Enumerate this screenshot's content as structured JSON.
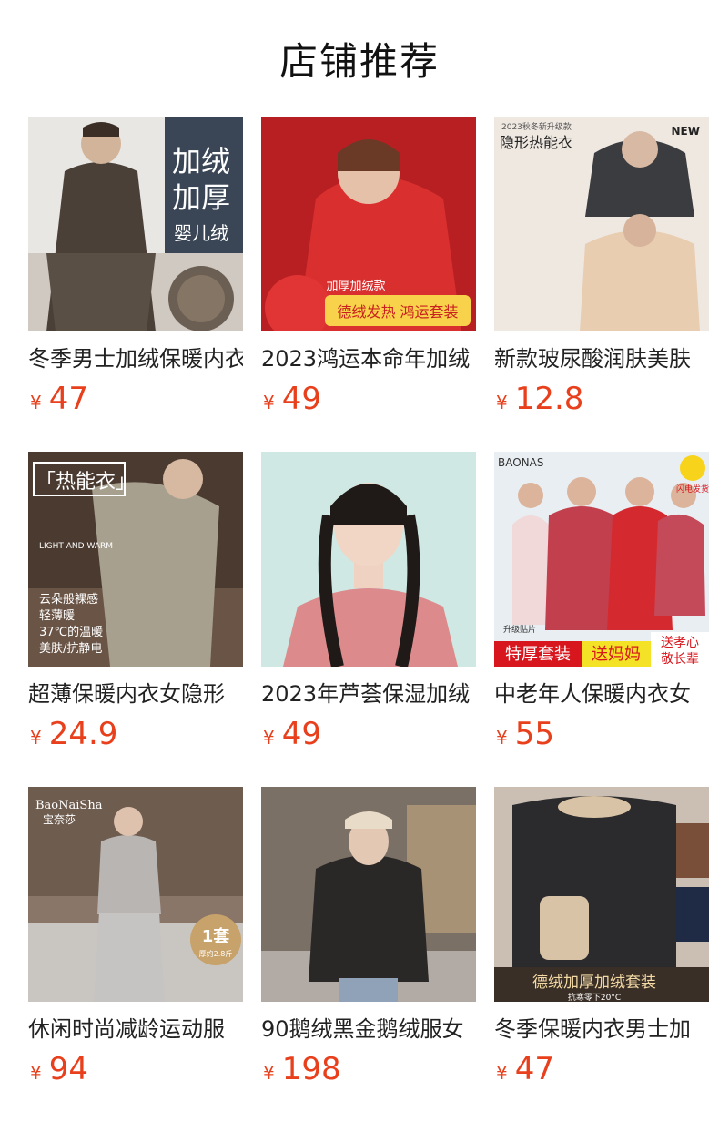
{
  "page": {
    "title": "店铺推荐"
  },
  "products": [
    {
      "title": "冬季男士加绒保暖内衣",
      "currency": "¥",
      "price": "47",
      "thumb_text": [
        "加绒",
        "加厚",
        "婴儿绒"
      ]
    },
    {
      "title": "2023鸿运本命年加绒",
      "currency": "¥",
      "price": "49",
      "thumb_text": [
        "加厚加绒款",
        "德绒发热 鸿运套装"
      ]
    },
    {
      "title": "新款玻尿酸润肤美肤",
      "currency": "¥",
      "price": "12.8",
      "thumb_text": [
        "2023秋冬新升级款",
        "隐形热能衣",
        "NEW"
      ]
    },
    {
      "title": "超薄保暖内衣女隐形",
      "currency": "¥",
      "price": "24.9",
      "thumb_text": [
        "「热能衣」",
        "LIGHT AND WARM",
        "云朵般裸感",
        "轻薄暖",
        "37℃的温暖",
        "美肤/抗静电"
      ]
    },
    {
      "title": "2023年芦荟保湿加绒",
      "currency": "¥",
      "price": "49",
      "thumb_text": []
    },
    {
      "title": "中老年人保暖内衣女",
      "currency": "¥",
      "price": "55",
      "thumb_text": [
        "BAONAS",
        "闪电发货",
        "特厚套装",
        "送妈妈",
        "送孝心",
        "敬长辈",
        "升级贴片"
      ]
    },
    {
      "title": "休闲时尚减龄运动服",
      "currency": "¥",
      "price": "94",
      "thumb_text": [
        "BaoNaiSha",
        "宝奈莎",
        "1套",
        "厚约2.8斤"
      ]
    },
    {
      "title": "90鹅绒黑金鹅绒服女",
      "currency": "¥",
      "price": "198",
      "thumb_text": []
    },
    {
      "title": "冬季保暖内衣男士加",
      "currency": "¥",
      "price": "47",
      "thumb_text": [
        "德绒加厚加绒套装",
        "抗寒零下20°C"
      ]
    }
  ],
  "colors": {
    "accent": "#e8401c",
    "title": "#222222"
  }
}
